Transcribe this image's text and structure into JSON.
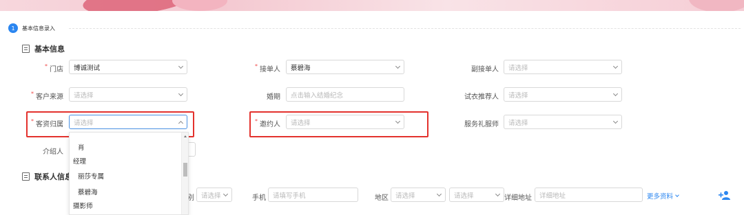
{
  "step": {
    "number": "1",
    "title": "基本信息录入"
  },
  "sections": {
    "basic": "基本信息",
    "contact": "联系人信息"
  },
  "fields": {
    "store": {
      "label": "门店",
      "value": "博诚测试"
    },
    "receiver": {
      "label": "接单人",
      "value": "蔡碧海"
    },
    "vice_receiver": {
      "label": "副接单人",
      "placeholder": "请选择"
    },
    "source": {
      "label": "客户来源",
      "placeholder": "请选择"
    },
    "wedding_date": {
      "label": "婚期",
      "placeholder": "点击输入结婚纪念"
    },
    "dress_recommender": {
      "label": "试衣推荐人",
      "placeholder": "请选择"
    },
    "owner": {
      "label": "客资归属",
      "placeholder": "请选择"
    },
    "inviter": {
      "label": "邀约人",
      "placeholder": "请选择"
    },
    "stylist": {
      "label": "服务礼服师",
      "placeholder": "请选择"
    },
    "introducer": {
      "label": "介绍人"
    }
  },
  "dropdown": {
    "items": [
      "肖",
      "经理",
      "丽莎专属",
      "蔡碧海",
      "摄影师"
    ]
  },
  "contact_row": {
    "gender_suffix": "别",
    "gender_placeholder": "请选择",
    "phone_label": "手机",
    "phone_placeholder": "请填写手机",
    "region_label": "地区",
    "region_placeholder1": "请选择",
    "region_placeholder2": "请选择",
    "address_label": "详细地址",
    "address_placeholder": "详细地址",
    "more_link": "更多资料"
  },
  "colors": {
    "accent": "#2b86f0",
    "required": "#f04a4a",
    "highlight": "#e3312c"
  }
}
